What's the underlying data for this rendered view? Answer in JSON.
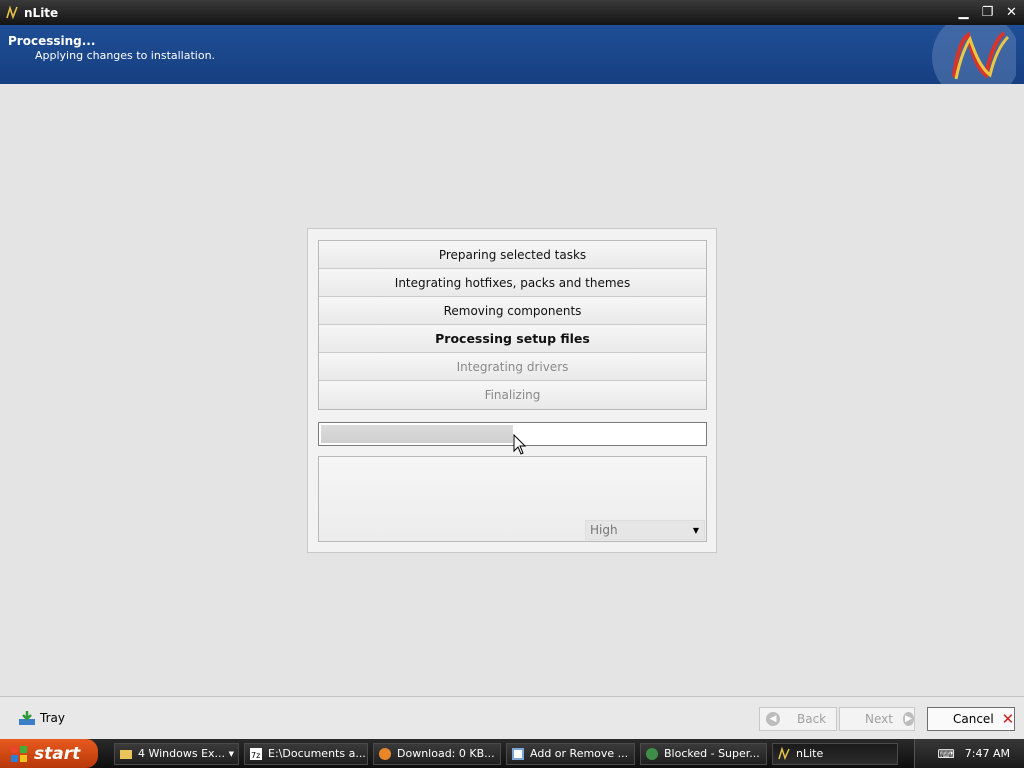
{
  "window": {
    "title": "nLite"
  },
  "header": {
    "title": "Processing...",
    "subtitle": "Applying changes to installation."
  },
  "steps": [
    {
      "label": "Preparing selected tasks",
      "state": "done"
    },
    {
      "label": "Integrating hotfixes, packs and themes",
      "state": "done"
    },
    {
      "label": "Removing components",
      "state": "done"
    },
    {
      "label": "Processing setup files",
      "state": "current"
    },
    {
      "label": "Integrating drivers",
      "state": "pending"
    },
    {
      "label": "Finalizing",
      "state": "pending"
    }
  ],
  "progress": {
    "fraction": 0.5
  },
  "priority": {
    "value": "High"
  },
  "bottom": {
    "tray_label": "Tray",
    "back_label": "Back",
    "next_label": "Next",
    "cancel_label": "Cancel"
  },
  "taskbar": {
    "start_label": "start",
    "tasks": [
      {
        "label": "4 Windows Ex...",
        "icon": "folder-icon"
      },
      {
        "label": "E:\\Documents a...",
        "icon": "7zip-icon"
      },
      {
        "label": "Download: 0 KB...",
        "icon": "firefox-icon"
      },
      {
        "label": "Add or Remove ...",
        "icon": "add-remove-icon"
      },
      {
        "label": "Blocked - Super...",
        "icon": "browser-icon"
      },
      {
        "label": "nLite",
        "icon": "nlite-icon"
      }
    ],
    "clock": "7:47 AM"
  },
  "colors": {
    "header_blue": "#1f4e96",
    "cancel_red": "#cc2222",
    "start_orange": "#e85a1e"
  }
}
